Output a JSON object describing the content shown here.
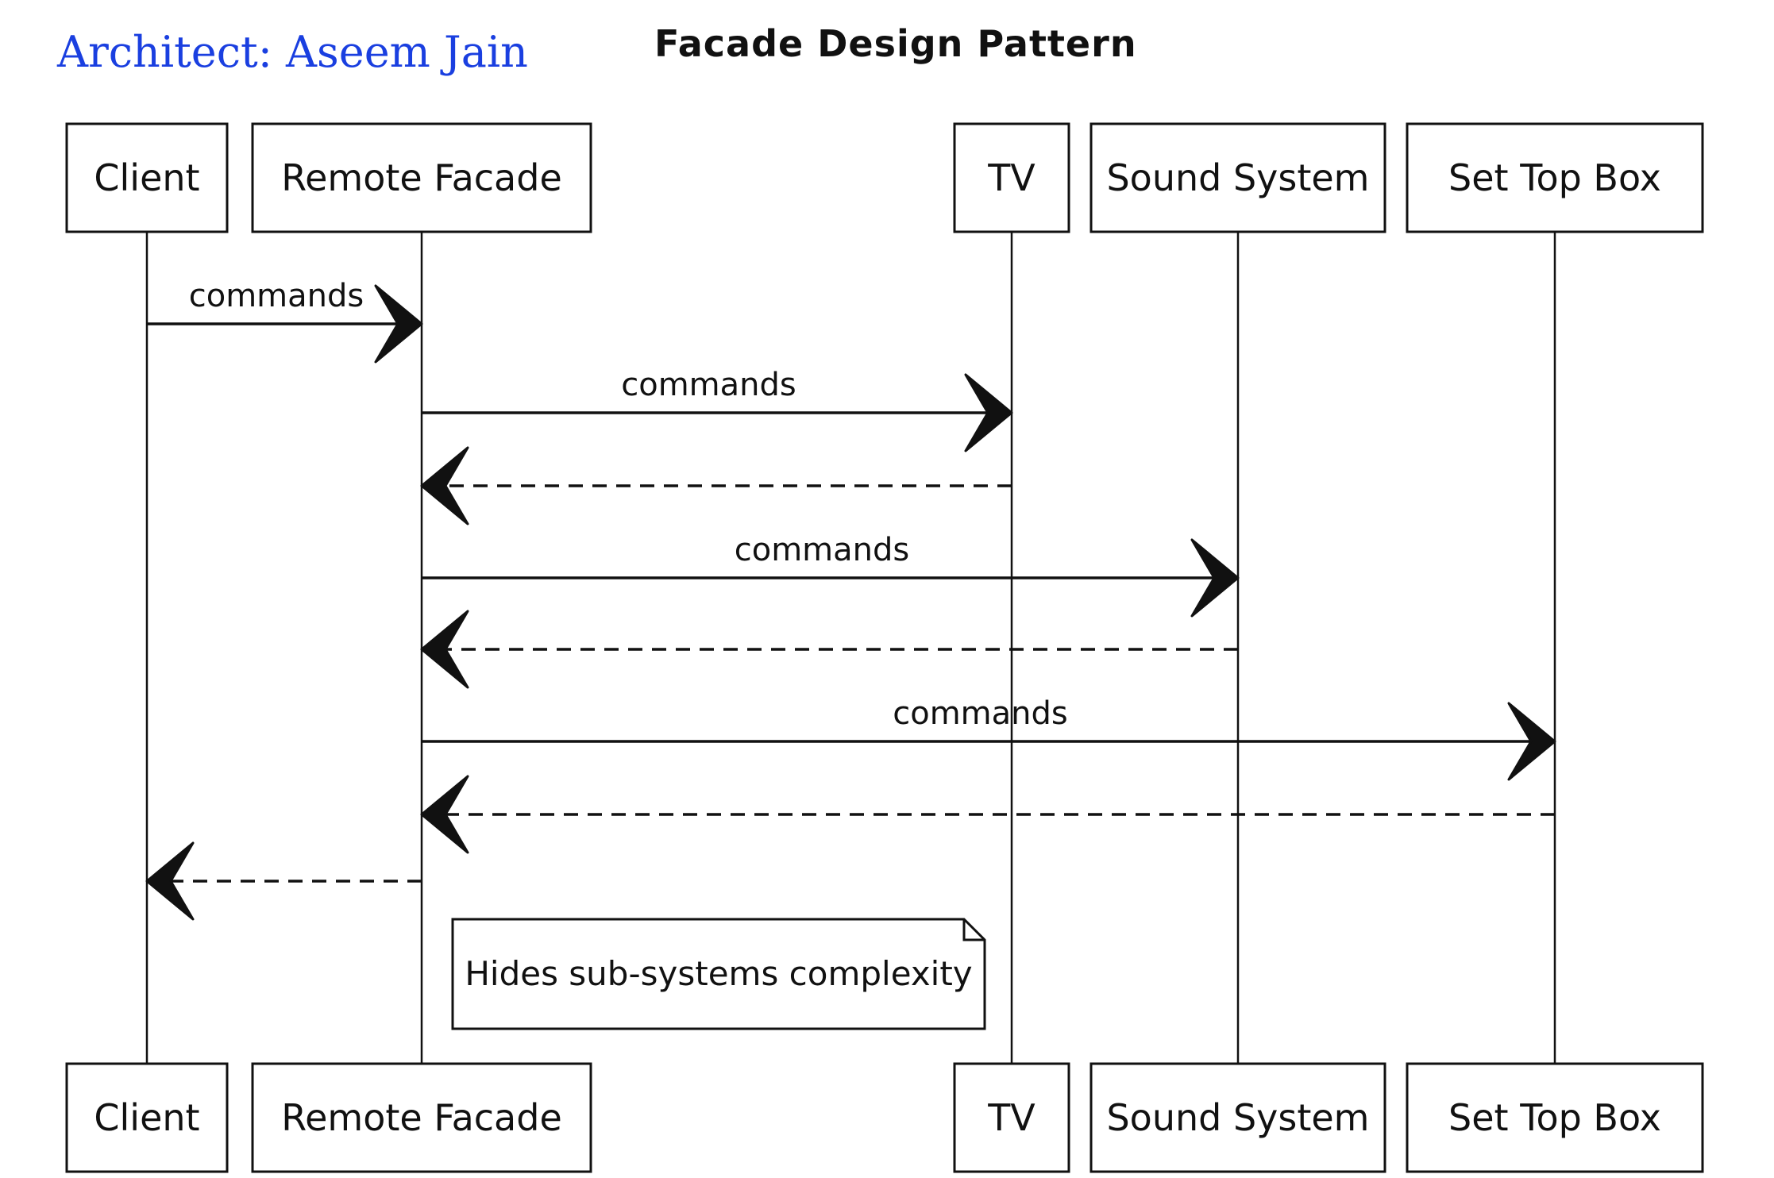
{
  "author": "Architect: Aseem Jain",
  "title": "Facade Design Pattern",
  "participants": [
    {
      "id": "client",
      "label": "Client"
    },
    {
      "id": "remote",
      "label": "Remote Facade"
    },
    {
      "id": "tv",
      "label": "TV"
    },
    {
      "id": "sound",
      "label": "Sound System"
    },
    {
      "id": "stb",
      "label": "Set Top Box"
    }
  ],
  "messages": [
    {
      "from": "client",
      "to": "remote",
      "label": "commands",
      "style": "solid"
    },
    {
      "from": "remote",
      "to": "tv",
      "label": "commands",
      "style": "solid"
    },
    {
      "from": "tv",
      "to": "remote",
      "label": "",
      "style": "dashed"
    },
    {
      "from": "remote",
      "to": "sound",
      "label": "commands",
      "style": "solid"
    },
    {
      "from": "sound",
      "to": "remote",
      "label": "",
      "style": "dashed"
    },
    {
      "from": "remote",
      "to": "stb",
      "label": "commands",
      "style": "solid"
    },
    {
      "from": "stb",
      "to": "remote",
      "label": "",
      "style": "dashed"
    },
    {
      "from": "remote",
      "to": "client",
      "label": "",
      "style": "dashed"
    }
  ],
  "note": {
    "text": "Hides sub-systems complexity"
  }
}
